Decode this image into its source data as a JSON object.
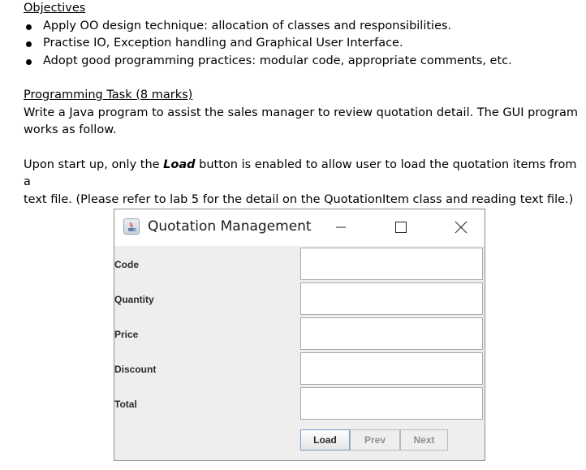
{
  "objectives": {
    "heading": "Objectives",
    "items": [
      "Apply OO design technique: allocation of classes and responsibilities.",
      "Practise IO, Exception handling and Graphical User Interface.",
      "Adopt good programming practices: modular code, appropriate comments, etc."
    ]
  },
  "task": {
    "heading": "Programming Task (8 marks)",
    "para1_line1": "Write a Java program to assist the sales manager to review quotation detail.  The GUI program",
    "para1_line2": "works as follow.",
    "para2_line1_pre": "Upon start up, only the ",
    "para2_line1_bold": "Load",
    "para2_line1_post": " button is enabled to allow user to load the quotation items from a",
    "para2_line2": "text file.  (Please refer to lab 5 for the detail on the QuotationItem class and reading text file.)"
  },
  "window": {
    "title": "Quotation Management",
    "icon": "java-cup-icon",
    "controls": [
      "minimize-icon",
      "maximize-icon",
      "close-icon"
    ],
    "fields": [
      {
        "label": "Code",
        "value": ""
      },
      {
        "label": "Quantity",
        "value": ""
      },
      {
        "label": "Price",
        "value": ""
      },
      {
        "label": "Discount",
        "value": ""
      },
      {
        "label": "Total",
        "value": ""
      }
    ],
    "buttons": {
      "load": "Load",
      "prev": "Prev",
      "next": "Next"
    }
  }
}
